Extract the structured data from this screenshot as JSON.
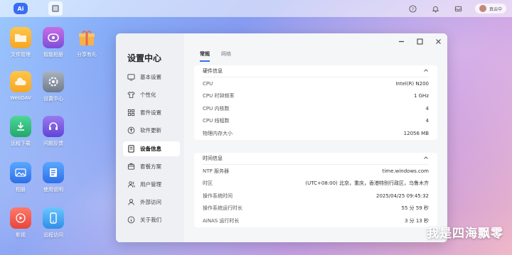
{
  "topbar": {
    "logo_text": "Ai",
    "user_label": "真云中"
  },
  "desktop": {
    "icons": [
      {
        "label": "文件管理",
        "icon": "folder-icon",
        "color": "#f5a623"
      },
      {
        "label": "智能相册",
        "icon": "photo-album-icon",
        "color": "#9b59d6"
      },
      {
        "label": "分享有礼",
        "icon": "gift-icon",
        "color": "#f4b24a"
      },
      {
        "label": "WebDAV",
        "icon": "cloud-folder-icon",
        "color": "#f5a623"
      },
      {
        "label": "设置中心",
        "icon": "settings-icon",
        "color": "#7f8a99"
      },
      {
        "label": "远程下载",
        "icon": "download-icon",
        "color": "#2ec27e"
      },
      {
        "label": "问题反馈",
        "icon": "headset-icon",
        "color": "#7b55e0"
      },
      {
        "label": "相册",
        "icon": "image-icon",
        "color": "#3a8cf4"
      },
      {
        "label": "使用说明",
        "icon": "manual-icon",
        "color": "#3a8cf4"
      },
      {
        "label": "影视",
        "icon": "play-icon",
        "color": "#f0564a"
      },
      {
        "label": "远程访问",
        "icon": "remote-phone-icon",
        "color": "#3aa6f4"
      }
    ]
  },
  "window": {
    "title": "设置中心",
    "nav": [
      {
        "label": "基本设置",
        "icon": "monitor-icon"
      },
      {
        "label": "个性化",
        "icon": "shirt-icon"
      },
      {
        "label": "套件设置",
        "icon": "grid-icon"
      },
      {
        "label": "软件更新",
        "icon": "update-icon"
      },
      {
        "label": "设备信息",
        "icon": "device-icon",
        "active": true
      },
      {
        "label": "套餐方案",
        "icon": "package-icon"
      },
      {
        "label": "用户管理",
        "icon": "users-icon"
      },
      {
        "label": "外部访问",
        "icon": "external-icon"
      },
      {
        "label": "关于我们",
        "icon": "info-icon"
      }
    ],
    "tabs": [
      {
        "label": "常规",
        "active": true
      },
      {
        "label": "网络"
      }
    ],
    "hardware": {
      "title": "硬件信息",
      "rows": [
        {
          "label": "CPU",
          "value": "Intel(R) N200"
        },
        {
          "label": "CPU 时钟频率",
          "value": "1 GHz"
        },
        {
          "label": "CPU 内核数",
          "value": "4"
        },
        {
          "label": "CPU 线程数",
          "value": "4"
        },
        {
          "label": "物理内存大小",
          "value": "12056 MB"
        }
      ]
    },
    "time": {
      "title": "时间信息",
      "rows": [
        {
          "label": "NTP 服务器",
          "value": "time.windows.com"
        },
        {
          "label": "时区",
          "value": "(UTC+08:00) 北京，重庆，香港特别行政区，乌鲁木齐"
        },
        {
          "label": "操作系统时间",
          "value": "2025/04/25 09:45:32"
        },
        {
          "label": "操作系统运行时长",
          "value": "55 分 59 秒"
        },
        {
          "label": "AiNAS 运行时长",
          "value": "3 分 13 秒"
        }
      ]
    }
  },
  "watermark": "我是四海飘零",
  "colors": {
    "accent": "#3a6cf4"
  }
}
